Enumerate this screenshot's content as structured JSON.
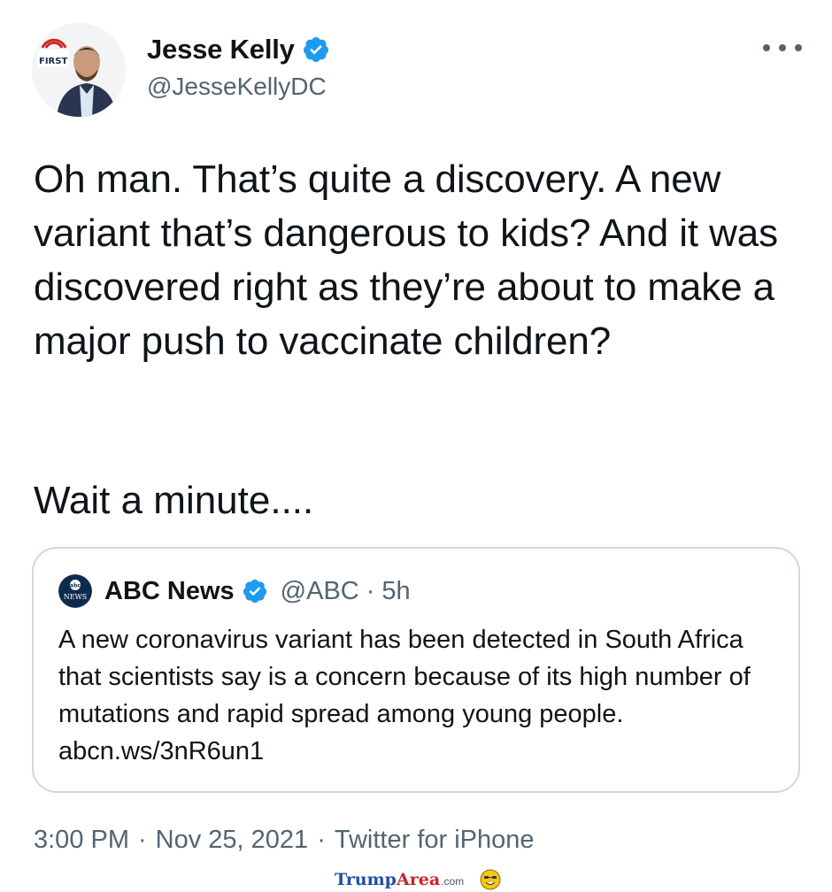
{
  "tweet": {
    "author": {
      "name": "Jesse Kelly",
      "handle": "@JesseKellyDC",
      "verified": true,
      "avatar_badge": "THE FIRST"
    },
    "text": "Oh man. That’s quite a discovery. A new variant that’s dangerous to kids? And it was discovered right as they’re about to make a major push to vaccinate children?",
    "text_2": "Wait a minute....",
    "quoted_tweet": {
      "logo_label": "abc NEWS",
      "name": "ABC News",
      "handle": "@ABC",
      "separator": "·",
      "time": "5h",
      "verified": true,
      "text": "A new coronavirus variant has been detected in South Africa that scientists say is a concern because of its high number of mutations and rapid spread among young people. abcn.ws/3nR6un1"
    },
    "meta": {
      "time": "3:00 PM",
      "date": "Nov 25, 2021",
      "source": "Twitter for iPhone",
      "separator": "·"
    }
  },
  "watermark": {
    "part1": "Trump",
    "part2": "Area",
    "part3": ".com"
  },
  "colors": {
    "verified_blue": "#1d9bf0",
    "text": "#0f1419",
    "secondary": "#536471",
    "border": "#cfd9de"
  },
  "icons": [
    "verified-badge-icon",
    "more-options-icon",
    "abc-news-logo-icon",
    "smiley-face-icon"
  ]
}
